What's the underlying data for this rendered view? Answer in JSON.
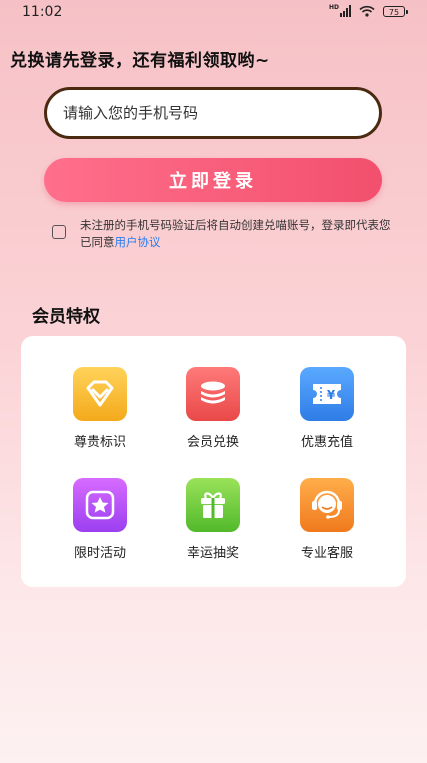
{
  "status_bar": {
    "time": "11:02",
    "network_label": "HD",
    "battery": "75"
  },
  "headline": "兑换请先登录，还有福利领取哟~",
  "login_form": {
    "phone_placeholder": "请输入您的手机号码",
    "login_button": "立即登录",
    "agreement_text": "未注册的手机号码验证后将自动创建兑喵账号，登录即代表您已同意",
    "agreement_link": "用户协议"
  },
  "privileges": {
    "title": "会员特权",
    "items": [
      {
        "label": "尊贵标识",
        "icon": "diamond-icon",
        "color": "#f4a91b"
      },
      {
        "label": "会员兑换",
        "icon": "coin-stack-icon",
        "color": "#e94848"
      },
      {
        "label": "优惠充值",
        "icon": "coupon-icon",
        "color": "#2f7de6"
      },
      {
        "label": "限时活动",
        "icon": "star-icon",
        "color": "#9b3ff0"
      },
      {
        "label": "幸运抽奖",
        "icon": "gift-icon",
        "color": "#52b92b"
      },
      {
        "label": "专业客服",
        "icon": "headset-icon",
        "color": "#f07a1e"
      }
    ]
  }
}
